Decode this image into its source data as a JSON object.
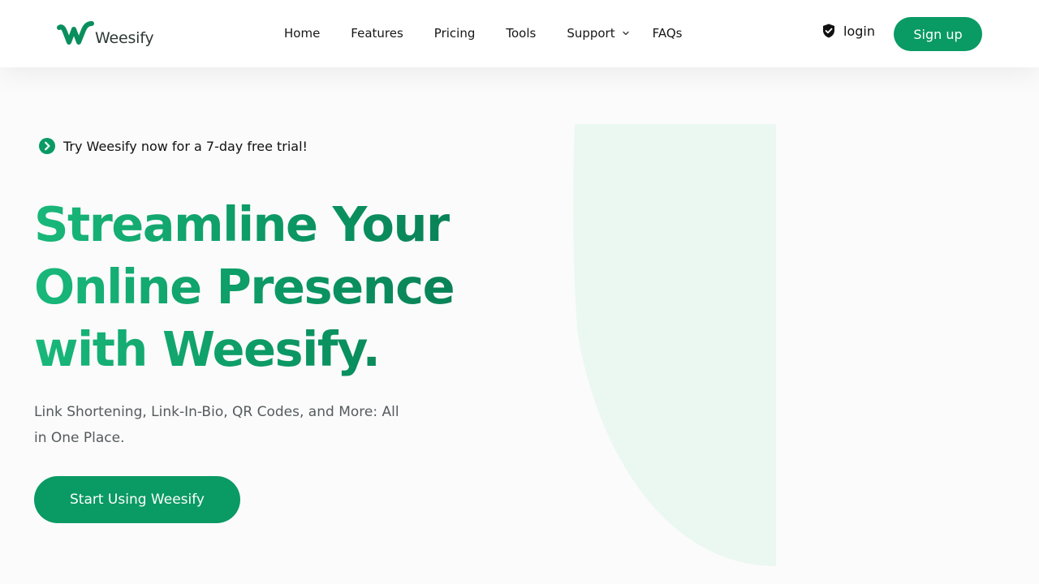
{
  "brand": {
    "name": "Weesify",
    "logo_icon": "weesify-w-logo",
    "primary_color": "#0a9a64",
    "gradient_start": "#19b87a",
    "gradient_end": "#087a52",
    "deco_color": "#eaf8f1"
  },
  "nav": {
    "items": [
      {
        "label": "Home"
      },
      {
        "label": "Features"
      },
      {
        "label": "Pricing"
      },
      {
        "label": "Tools"
      },
      {
        "label": "Support",
        "has_dropdown": true
      },
      {
        "label": "FAQs"
      }
    ],
    "login_label": "login",
    "login_icon": "shield-check-icon",
    "signup_label": "Sign up"
  },
  "hero": {
    "trial_icon": "chevron-right-circle-icon",
    "trial_text": "Try Weesify now for a 7-day free trial!",
    "headline": [
      "Streamline Your",
      "Online Presence",
      "with Weesify."
    ],
    "subtitle": "Link Shortening, Link-In-Bio, QR Codes, and More: All in One Place.",
    "cta_label": "Start Using Weesify"
  }
}
